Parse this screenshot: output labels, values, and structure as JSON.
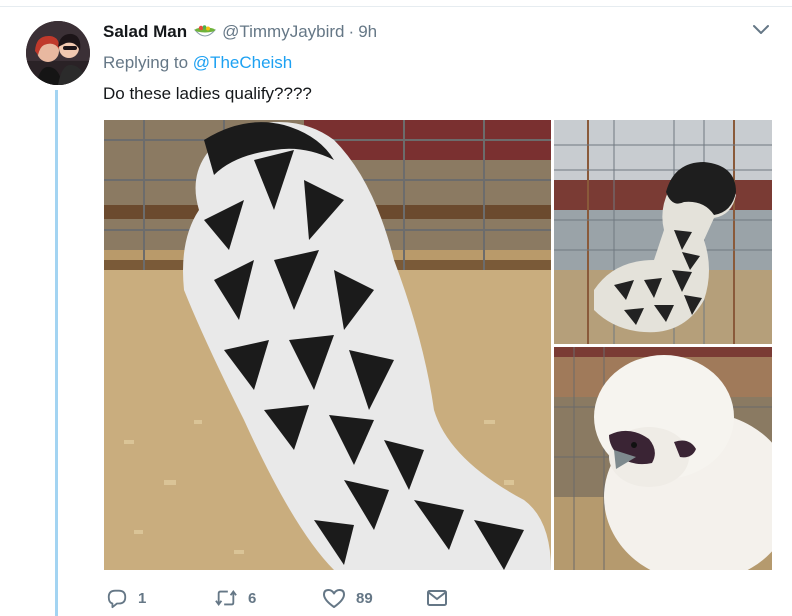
{
  "tweet": {
    "author_name": "Salad Man",
    "author_emoji_icon": "salad-emoji-icon",
    "handle": "@TimmyJaybird",
    "separator": "·",
    "time": "9h",
    "replying_prefix": "Replying to",
    "replying_to": "@TheCheish",
    "text": "Do these ladies qualify????"
  },
  "media": {
    "count": 3,
    "photos": [
      {
        "subject": "black-and-white laced chicken in pen"
      },
      {
        "subject": "crested chicken in wire cage"
      },
      {
        "subject": "white silkie chicken close-up"
      }
    ]
  },
  "actions": {
    "reply_count": "1",
    "retweet_count": "6",
    "like_count": "89",
    "icons": [
      "reply-icon",
      "retweet-icon",
      "like-icon",
      "message-icon"
    ]
  },
  "colors": {
    "link": "#1da1f2",
    "secondary_text": "#657786",
    "thread_line": "#a3d4f2"
  }
}
